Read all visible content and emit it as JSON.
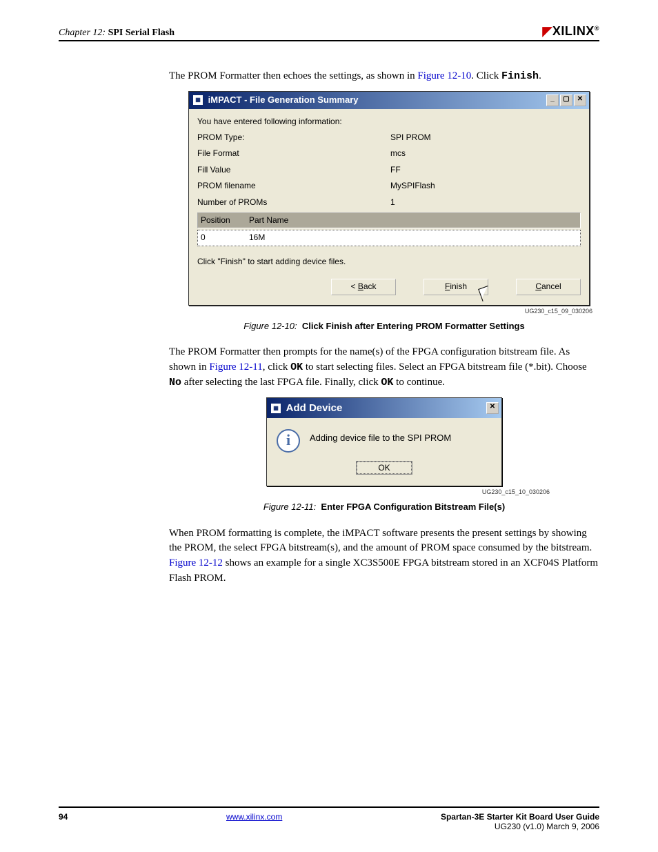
{
  "header": {
    "chapter": "Chapter 12:",
    "section": "SPI Serial Flash",
    "logo": "XILINX",
    "logo_sup": "®"
  },
  "para1_a": "The PROM Formatter then echoes the settings, as shown in ",
  "para1_link": "Figure 12-10",
  "para1_b": ". Click ",
  "para1_mono": "Finish",
  "para1_c": ".",
  "dlg1": {
    "title": "iMPACT - File Generation Summary",
    "intro": "You have entered following information:",
    "rows": {
      "prom_type_l": "PROM Type:",
      "prom_type_v": "SPI PROM",
      "file_fmt_l": "File Format",
      "file_fmt_v": "mcs",
      "fill_l": "Fill Value",
      "fill_v": "FF",
      "fname_l": "PROM filename",
      "fname_v": "MySPIFlash",
      "num_l": "Number of PROMs",
      "num_v": "1"
    },
    "th_pos": "Position",
    "th_part": "Part Name",
    "td_pos": "0",
    "td_part": "16M",
    "hint": "Click \"Finish\" to start adding device files.",
    "back_pre": "< ",
    "back_u": "B",
    "back_post": "ack",
    "finish_u": "F",
    "finish_post": "inish",
    "cancel_u": "C",
    "cancel_post": "ancel"
  },
  "figid1": "UG230_c15_09_030206",
  "figcap1_num": "Figure 12-10:",
  "figcap1_title": "Click Finish after Entering PROM Formatter Settings",
  "para2_a": "The PROM Formatter then prompts for the name(s) of the FPGA configuration bitstream file. As shown in ",
  "para2_link": "Figure 12-11",
  "para2_b": ", click ",
  "para2_mono1": "OK",
  "para2_c": " to start selecting files. Select an FPGA bitstream file (*.bit). Choose ",
  "para2_mono2": "No",
  "para2_d": " after selecting the last FPGA file. Finally, click ",
  "para2_mono3": "OK",
  "para2_e": " to continue.",
  "dlg2": {
    "title": "Add Device",
    "msg": "Adding device file to the SPI PROM",
    "ok": "OK"
  },
  "figid2": "UG230_c15_10_030206",
  "figcap2_num": "Figure 12-11:",
  "figcap2_title": "Enter FPGA Configuration Bitstream File(s)",
  "para3_a": "When PROM formatting is complete, the iMPACT software presents the present settings by showing the PROM, the select FPGA bitstream(s), and the amount of PROM space consumed by the bitstream. ",
  "para3_link": "Figure 12-12",
  "para3_b": " shows an example for a single XC3S500E FPGA bitstream stored in an XCF04S Platform Flash PROM.",
  "footer": {
    "page": "94",
    "url": "www.xilinx.com",
    "guide": "Spartan-3E Starter Kit Board User Guide",
    "ver": "UG230 (v1.0) March 9, 2006"
  }
}
